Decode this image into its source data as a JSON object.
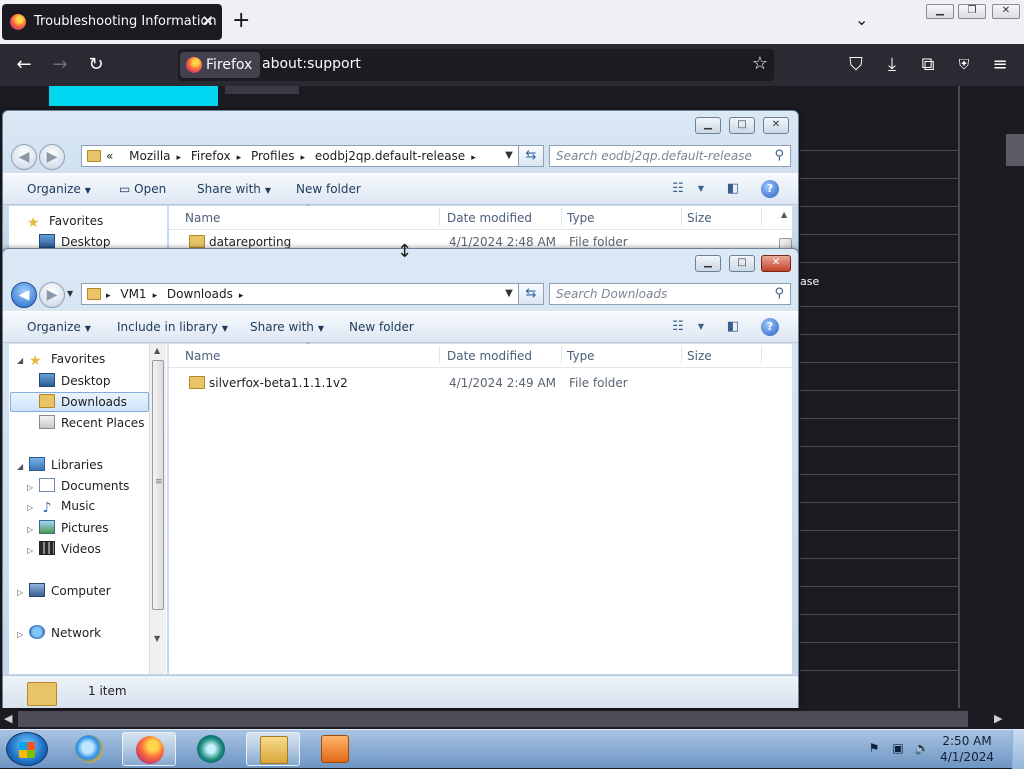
{
  "firefox": {
    "tab_title": "Troubleshooting Information",
    "tab_close": "✕",
    "new_tab": "+",
    "identity_label": "Firefox",
    "url": "about:support",
    "page_peek_text": "ase"
  },
  "window_back": {
    "breadcrumb": [
      "«",
      "Mozilla",
      "Firefox",
      "Profiles",
      "eodbj2qp.default-release"
    ],
    "search_placeholder": "Search eodbj2qp.default-release",
    "commands": {
      "organize": "Organize",
      "open": "Open",
      "share_with": "Share with",
      "new_folder": "New folder"
    },
    "columns": {
      "name": "Name",
      "date_modified": "Date modified",
      "type": "Type",
      "size": "Size"
    },
    "nav": {
      "favorites": "Favorites",
      "desktop": "Desktop"
    },
    "rows": [
      {
        "name": "datareporting",
        "date": "4/1/2024 2:48 AM",
        "type": "File folder"
      }
    ]
  },
  "window_front": {
    "breadcrumb": [
      "VM1",
      "Downloads"
    ],
    "search_placeholder": "Search Downloads",
    "commands": {
      "organize": "Organize",
      "include_in_library": "Include in library",
      "share_with": "Share with",
      "new_folder": "New folder"
    },
    "columns": {
      "name": "Name",
      "date_modified": "Date modified",
      "type": "Type",
      "size": "Size"
    },
    "nav": {
      "favorites": "Favorites",
      "desktop": "Desktop",
      "downloads": "Downloads",
      "recent_places": "Recent Places",
      "libraries": "Libraries",
      "documents": "Documents",
      "music": "Music",
      "pictures": "Pictures",
      "videos": "Videos",
      "computer": "Computer",
      "network": "Network"
    },
    "rows": [
      {
        "name": "silverfox-beta1.1.1.1v2",
        "date": "4/1/2024 2:49 AM",
        "type": "File folder"
      }
    ],
    "status": "1 item"
  },
  "taskbar": {
    "time": "2:50 AM",
    "date": "4/1/2024",
    "apps": [
      "internet-explorer-icon",
      "firefox-icon",
      "app-icon",
      "explorer-icon",
      "media-player-icon"
    ]
  },
  "colors": {
    "firefox_dark": "#1c1b22",
    "firefox_toolbar": "#2b2a33",
    "page_cyan": "#00d6f0",
    "aero_blue": "#c3d6ea",
    "close_red": "#c3422a"
  }
}
